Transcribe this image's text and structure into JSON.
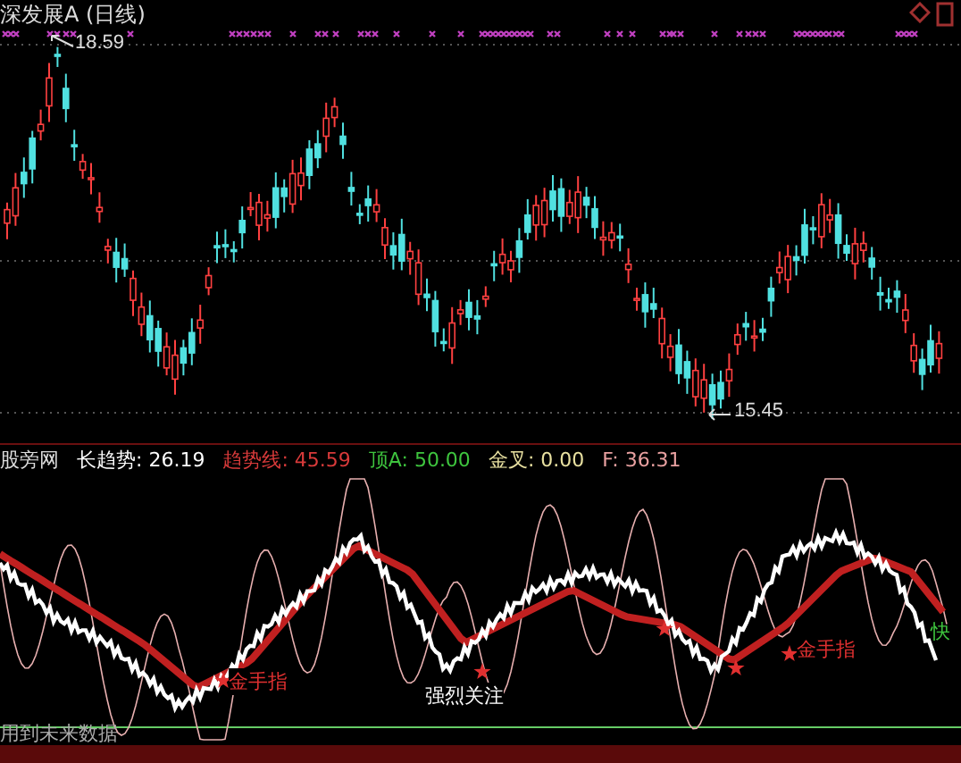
{
  "title": "深发展A (日线)",
  "price_chart": {
    "high_label": "18.59",
    "low_label": "15.45"
  },
  "indicator": {
    "name": "股旁网",
    "values": [
      {
        "text": "长趋势: 26.19",
        "color": "#ffffff"
      },
      {
        "text": "趋势线: 45.59",
        "color": "#d83a3a"
      },
      {
        "text": "顶A: 50.00",
        "color": "#3ec43e"
      },
      {
        "text": "金叉: 0.00",
        "color": "#e8e0a0"
      },
      {
        "text": "F: 36.31",
        "color": "#e8a0a0"
      }
    ]
  },
  "signals": [
    {
      "text": "金手指",
      "kind": "buy"
    },
    {
      "text": "强烈关注",
      "kind": "focus"
    },
    {
      "text": "金手指",
      "kind": "buy"
    },
    {
      "text": "快",
      "kind": "fast"
    }
  ],
  "note": "用到未来数据"
}
